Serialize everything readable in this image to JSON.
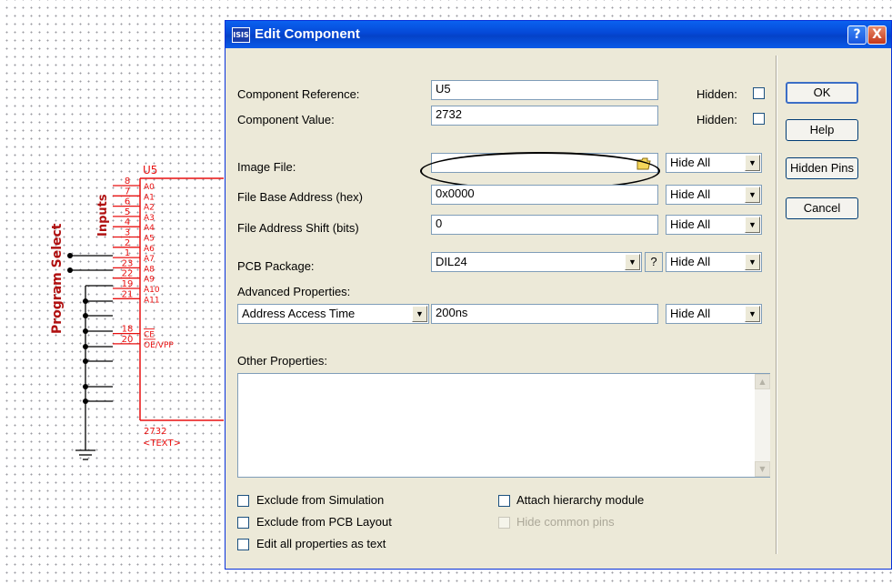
{
  "schematic": {
    "ref": "U5",
    "value": "2732",
    "text_tag": "<TEXT>",
    "inputs_label": "Inputs",
    "program_select_label": "Program Select",
    "pins": [
      {
        "num": "8",
        "name": "A0"
      },
      {
        "num": "7",
        "name": "A1"
      },
      {
        "num": "6",
        "name": "A2"
      },
      {
        "num": "5",
        "name": "A3"
      },
      {
        "num": "4",
        "name": "A4"
      },
      {
        "num": "3",
        "name": "A5"
      },
      {
        "num": "2",
        "name": "A6"
      },
      {
        "num": "1",
        "name": "A7"
      },
      {
        "num": "23",
        "name": "A8"
      },
      {
        "num": "22",
        "name": "A9"
      },
      {
        "num": "19",
        "name": "A10"
      },
      {
        "num": "21",
        "name": "A11"
      },
      {
        "num": "18",
        "name": "CE"
      },
      {
        "num": "20",
        "name": "OE/VPP"
      }
    ],
    "wire_color": "#e81010"
  },
  "dialog": {
    "title": "Edit Component",
    "title_icon": "ISIS",
    "help_glyph": "?",
    "close_glyph": "X",
    "component_reference_label": "Component Reference:",
    "component_reference_value": "U5",
    "component_value_label": "Component Value:",
    "component_value_value": "2732",
    "hidden_label": "Hidden:",
    "image_file_label": "Image File:",
    "image_file_value": "",
    "file_base_address_label": "File Base Address (hex)",
    "file_base_address_value": "0x0000",
    "file_address_shift_label": "File Address Shift (bits)",
    "file_address_shift_value": "0",
    "pcb_package_label": "PCB Package:",
    "pcb_package_value": "DIL24",
    "pcb_help_glyph": "?",
    "hide_all": "Hide All",
    "advanced_properties_label": "Advanced Properties:",
    "advanced_property_selected": "Address Access Time",
    "advanced_property_value": "200ns",
    "other_properties_label": "Other Properties:",
    "other_properties_value": "",
    "checkboxes": {
      "exclude_simulation": "Exclude from Simulation",
      "exclude_pcb": "Exclude from PCB Layout",
      "edit_all_text": "Edit all properties as text",
      "attach_hierarchy": "Attach hierarchy module",
      "hide_common_pins": "Hide common pins"
    },
    "buttons": {
      "ok": "OK",
      "help": "Help",
      "hidden_pins": "Hidden Pins",
      "cancel": "Cancel"
    }
  }
}
